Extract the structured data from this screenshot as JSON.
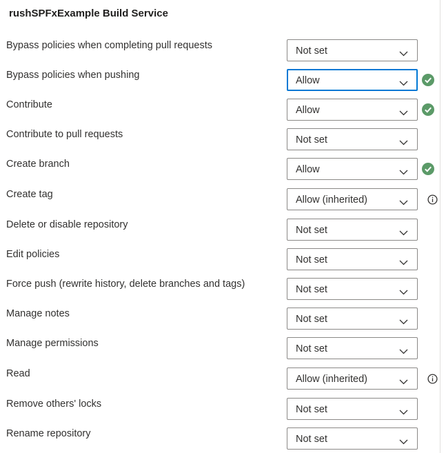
{
  "header": {
    "title": "rushSPFxExample Build Service"
  },
  "permissions": [
    {
      "label": "Bypass policies when completing pull requests",
      "value": "Not set",
      "status": "none"
    },
    {
      "label": "Bypass policies when pushing",
      "value": "Allow",
      "status": "check",
      "focused": true
    },
    {
      "label": "Contribute",
      "value": "Allow",
      "status": "check"
    },
    {
      "label": "Contribute to pull requests",
      "value": "Not set",
      "status": "none"
    },
    {
      "label": "Create branch",
      "value": "Allow",
      "status": "check"
    },
    {
      "label": "Create tag",
      "value": "Allow (inherited)",
      "status": "info"
    },
    {
      "label": "Delete or disable repository",
      "value": "Not set",
      "status": "none"
    },
    {
      "label": "Edit policies",
      "value": "Not set",
      "status": "none"
    },
    {
      "label": "Force push (rewrite history, delete branches and tags)",
      "value": "Not set",
      "status": "none"
    },
    {
      "label": "Manage notes",
      "value": "Not set",
      "status": "none"
    },
    {
      "label": "Manage permissions",
      "value": "Not set",
      "status": "none"
    },
    {
      "label": "Read",
      "value": "Allow (inherited)",
      "status": "info"
    },
    {
      "label": "Remove others' locks",
      "value": "Not set",
      "status": "none"
    },
    {
      "label": "Rename repository",
      "value": "Not set",
      "status": "none"
    }
  ],
  "colors": {
    "accent": "#0078d4",
    "success": "#5b9a68",
    "info": "#323130",
    "border": "#8a8886"
  },
  "icons": {
    "check": "checkmark-circle-icon",
    "info": "info-icon",
    "chevron": "chevron-down-icon"
  }
}
